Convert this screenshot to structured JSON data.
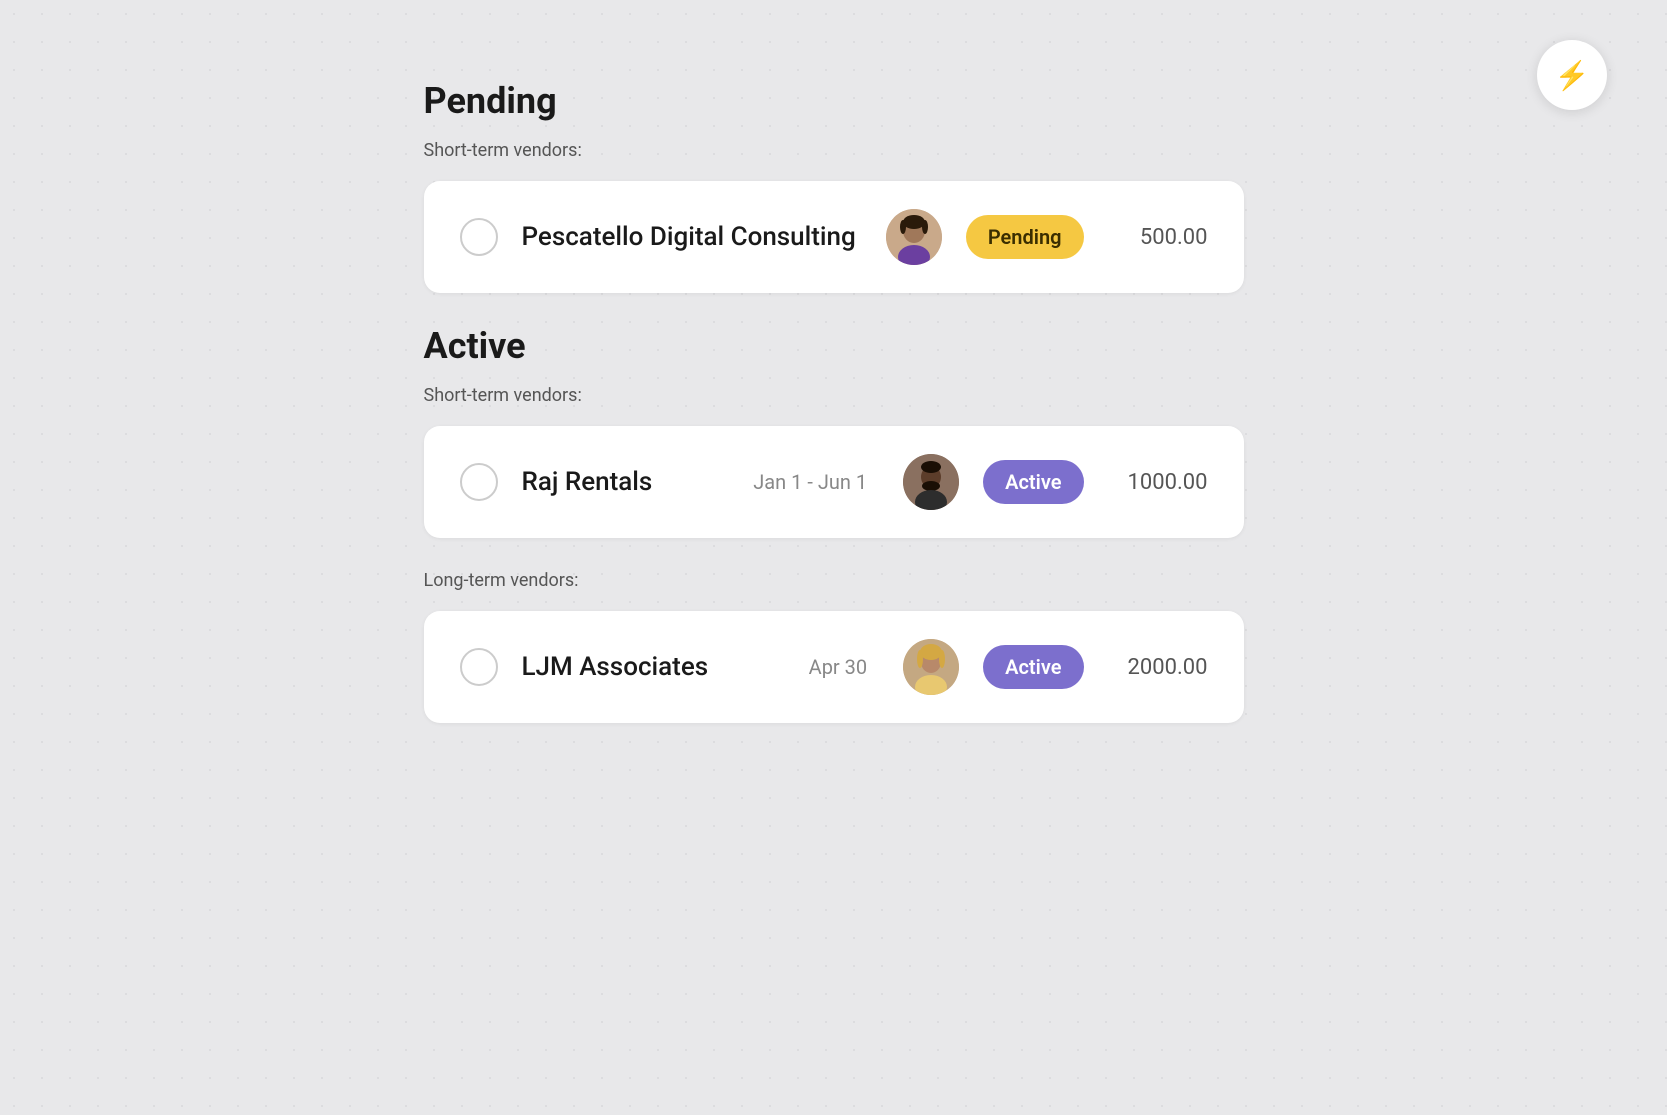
{
  "lightning_button": {
    "icon": "⚡"
  },
  "sections": [
    {
      "id": "pending",
      "title": "Pending",
      "subtitle": "Short-term vendors:",
      "vendors": [
        {
          "id": "pescatello",
          "name": "Pescatello Digital Consulting",
          "date": "",
          "status": "Pending",
          "status_type": "pending",
          "amount": "500.00",
          "avatar_class": "avatar-1"
        }
      ]
    },
    {
      "id": "active",
      "title": "Active",
      "groups": [
        {
          "subtitle": "Short-term vendors:",
          "vendors": [
            {
              "id": "raj-rentals",
              "name": "Raj Rentals",
              "date": "Jan 1 - Jun 1",
              "status": "Active",
              "status_type": "active",
              "amount": "1000.00",
              "avatar_class": "avatar-2"
            }
          ]
        },
        {
          "subtitle": "Long-term vendors:",
          "vendors": [
            {
              "id": "ljm-associates",
              "name": "LJM Associates",
              "date": "Apr 30",
              "status": "Active",
              "status_type": "active",
              "amount": "2000.00",
              "avatar_class": "avatar-3"
            }
          ]
        }
      ]
    }
  ]
}
